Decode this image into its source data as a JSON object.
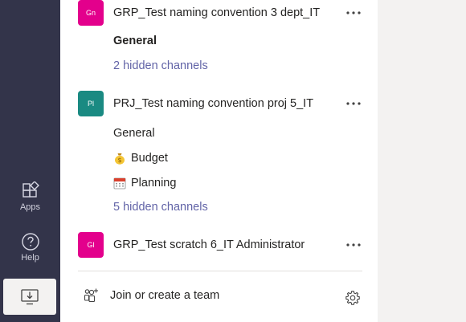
{
  "rail": {
    "apps_label": "Apps",
    "help_label": "Help"
  },
  "teams": [
    {
      "avatar_text": "Gn",
      "avatar_color": "#e3008c",
      "name": "GRP_Test naming convention 3 dept_IT",
      "channels": [
        {
          "label": "General",
          "bold": true
        },
        {
          "label": "2 hidden channels",
          "link": true
        }
      ]
    },
    {
      "avatar_text": "Pl",
      "avatar_color": "#1a8a82",
      "name": "PRJ_Test naming convention proj 5_IT",
      "channels": [
        {
          "label": "General"
        },
        {
          "label": "Budget",
          "icon": "money-bag-icon"
        },
        {
          "label": "Planning",
          "icon": "calendar-icon"
        },
        {
          "label": "5 hidden channels",
          "link": true
        }
      ]
    },
    {
      "avatar_text": "Gl",
      "avatar_color": "#e3008c",
      "name": "GRP_Test scratch 6_IT Administrator",
      "channels": []
    }
  ],
  "footer": {
    "join_label": "Join or create a team"
  },
  "colors": {
    "rail_bg": "#33344a",
    "link": "#6264a7",
    "panel_bg": "#ffffff"
  }
}
